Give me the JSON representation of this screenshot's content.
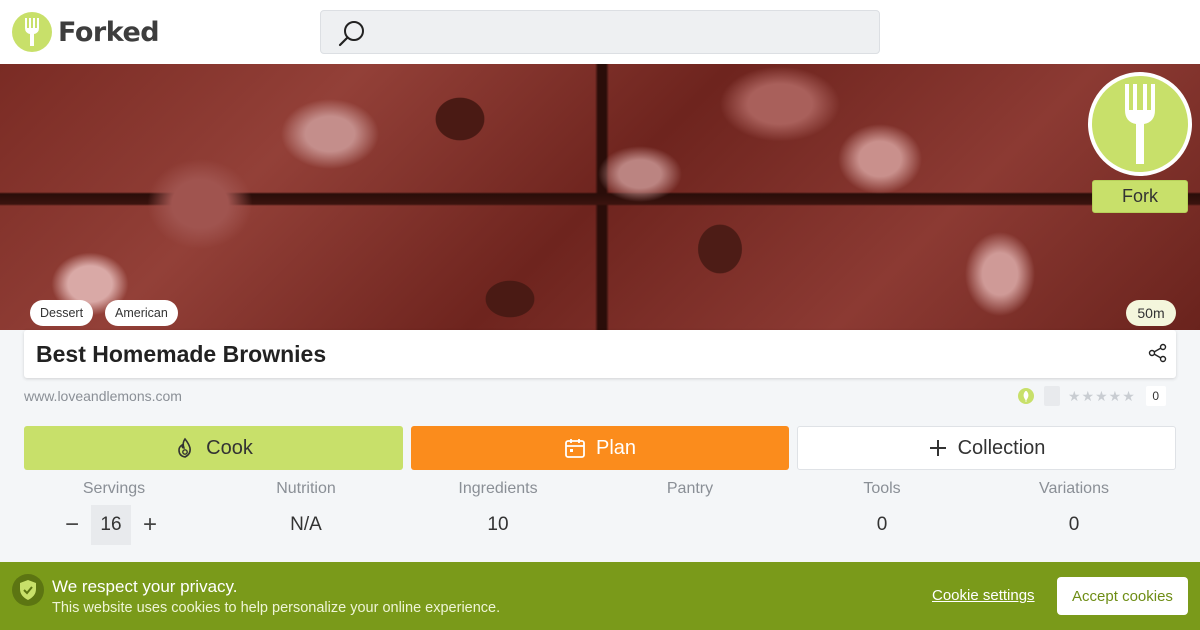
{
  "header": {
    "logo_text": "Forked",
    "search": {
      "placeholder": "",
      "value": ""
    }
  },
  "recipe": {
    "tags": [
      "Dessert",
      "American"
    ],
    "time": "50m",
    "title": "Best Homemade Brownies",
    "source": "www.loveandlemons.com",
    "rating_count": "0",
    "fork_label": "Fork"
  },
  "actions": {
    "cook": "Cook",
    "plan": "Plan",
    "collection": "Collection"
  },
  "stats": {
    "servings": {
      "label": "Servings",
      "value": "16",
      "minus": "−",
      "plus": "+"
    },
    "nutrition": {
      "label": "Nutrition",
      "value": "N/A"
    },
    "ingredients": {
      "label": "Ingredients",
      "value": "10"
    },
    "pantry": {
      "label": "Pantry",
      "value": ""
    },
    "tools": {
      "label": "Tools",
      "value": "0"
    },
    "variations": {
      "label": "Variations",
      "value": "0"
    }
  },
  "cookie_banner": {
    "title": "We respect your privacy.",
    "text": "This website uses cookies to help personalize your online experience.",
    "settings": "Cookie settings",
    "accept": "Accept cookies"
  },
  "colors": {
    "brand_green": "#c8e06a",
    "plan_orange": "#fb8c1c",
    "cookie_bg": "#7a9a1a"
  }
}
